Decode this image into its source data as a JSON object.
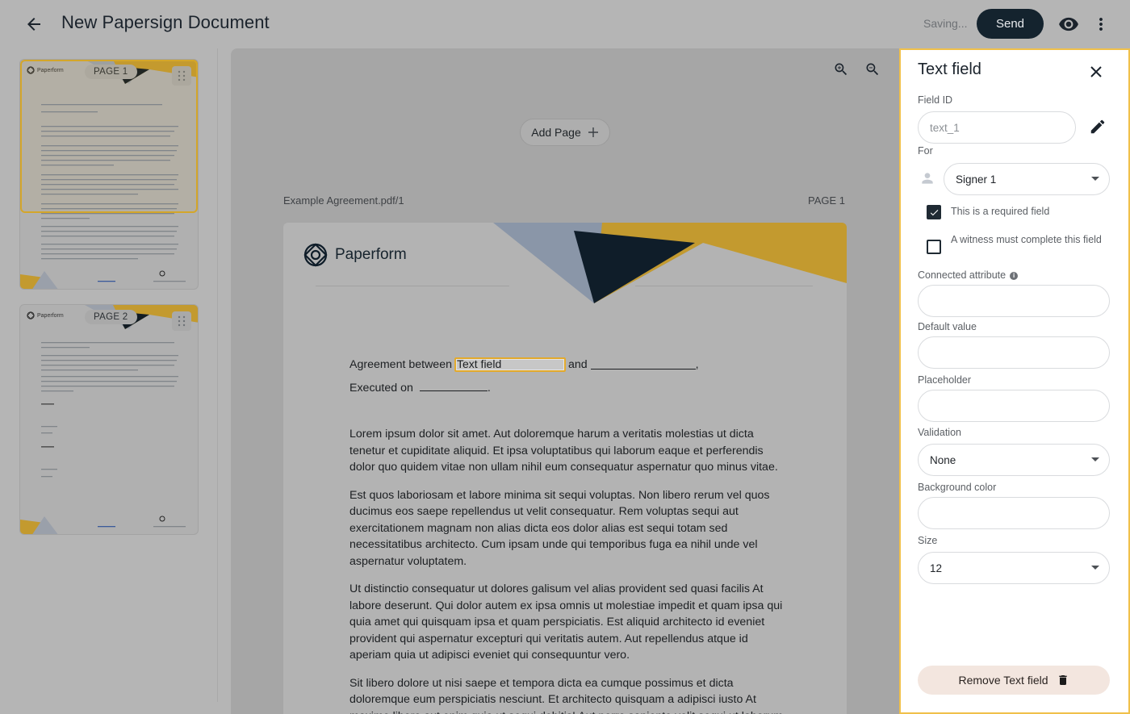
{
  "header": {
    "title": "New Papersign Document",
    "status": "Saving...",
    "send_label": "Send"
  },
  "thumbnails": [
    {
      "label": "PAGE 1",
      "brand": "Paperform",
      "selected": true
    },
    {
      "label": "PAGE 2",
      "brand": "Paperform",
      "selected": false
    }
  ],
  "canvas": {
    "add_page_label": "Add Page",
    "file_name": "Example Agreement.pdf/1",
    "page_label": "PAGE 1"
  },
  "document": {
    "brand": "Paperform",
    "agreement_prefix": "Agreement between",
    "field_value": "Text field",
    "agreement_mid": "and",
    "agreement_suffix": ",",
    "executed_on": "Executed on",
    "executed_suffix": ".",
    "paragraphs": [
      "Lorem ipsum dolor sit amet. Aut doloremque harum a veritatis molestias ut dicta tenetur et cupiditate aliquid. Et ipsa voluptatibus qui laborum eaque et perferendis dolor quo quidem vitae non ullam nihil eum consequatur aspernatur quo minus vitae.",
      "Est quos laboriosam et labore minima sit sequi voluptas. Non libero rerum vel quos ducimus eos saepe repellendus ut velit consequatur. Rem voluptas sequi aut exercitationem magnam non alias dicta eos dolor alias est sequi totam sed necessitatibus architecto. Cum ipsam unde qui temporibus fuga ea nihil unde vel aspernatur voluptatem.",
      "Ut distinctio consequatur ut dolores galisum vel alias provident sed quasi facilis At labore deserunt. Qui dolor autem ex ipsa omnis ut molestiae impedit et quam ipsa qui quia amet qui quisquam ipsa et quam perspiciatis. Est aliquid architecto id eveniet provident qui aspernatur excepturi qui veritatis autem. Aut repellendus atque id aperiam quia ut adipisci eveniet qui consequuntur vero.",
      "Sit libero dolore ut nisi saepe et tempora dicta ea cumque possimus et dicta doloremque eum perspiciatis nesciunt. Et architecto quisquam a adipisci iusto At maxime libero aut enim quia ut sequi debitis! Aut porro sapiente velit sequi ut laborum"
    ]
  },
  "panel": {
    "title": "Text field",
    "field_id_label": "Field ID",
    "field_id_placeholder": "text_1",
    "for_label": "For",
    "signer_value": "Signer 1",
    "required_label": "This is a required field",
    "required_checked": true,
    "witness_label": "A witness must complete this field",
    "witness_checked": false,
    "connected_label": "Connected attribute",
    "connected_value": "",
    "default_label": "Default value",
    "default_value": "",
    "placeholder_label": "Placeholder",
    "placeholder_value": "",
    "validation_label": "Validation",
    "validation_value": "None",
    "bg_color_label": "Background color",
    "bg_color_value": "",
    "size_label": "Size",
    "size_value": "12",
    "remove_label": "Remove Text field"
  },
  "colors": {
    "accent": "#f0c04a",
    "send_button": "#14232e",
    "remove_button_bg": "#f3e6df",
    "brand_dark": "#0f1d29",
    "brand_gold": "#d4a62a",
    "brand_slate": "#8a96a8"
  },
  "icons": [
    "arrow-back-icon",
    "eye-icon",
    "more-vert-icon",
    "drag-handle-icon",
    "zoom-in-icon",
    "zoom-out-icon",
    "plus-icon",
    "close-icon",
    "pencil-icon",
    "person-icon",
    "check-icon",
    "info-icon",
    "trash-icon",
    "paperform-logo-icon"
  ]
}
